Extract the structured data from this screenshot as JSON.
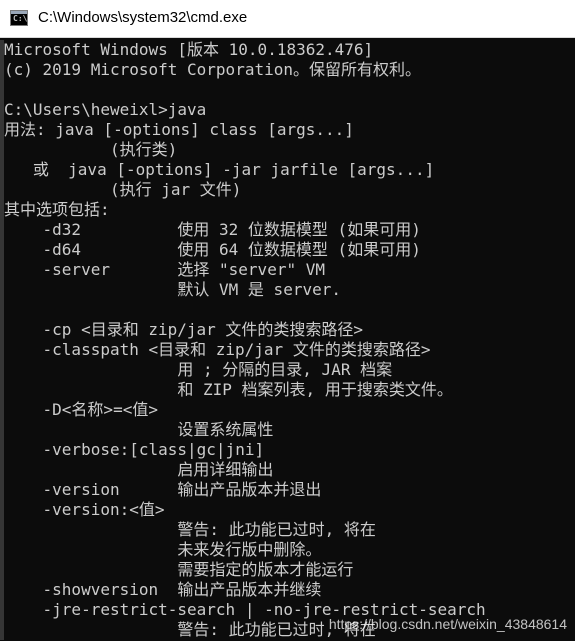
{
  "window": {
    "title": "C:\\Windows\\system32\\cmd.exe",
    "icon": "cmd-console-icon"
  },
  "colors": {
    "background": "#0c0c0c",
    "text": "#cccccc",
    "titlebar": "#ffffff"
  },
  "console": {
    "lines": [
      "Microsoft Windows [版本 10.0.18362.476]",
      "(c) 2019 Microsoft Corporation。保留所有权利。",
      "",
      "C:\\Users\\heweixl>java",
      "用法: java [-options] class [args...]",
      "           (执行类)",
      "   或  java [-options] -jar jarfile [args...]",
      "           (执行 jar 文件)",
      "其中选项包括:",
      "    -d32          使用 32 位数据模型 (如果可用)",
      "    -d64          使用 64 位数据模型 (如果可用)",
      "    -server       选择 \"server\" VM",
      "                  默认 VM 是 server.",
      "",
      "    -cp <目录和 zip/jar 文件的类搜索路径>",
      "    -classpath <目录和 zip/jar 文件的类搜索路径>",
      "                  用 ; 分隔的目录, JAR 档案",
      "                  和 ZIP 档案列表, 用于搜索类文件。",
      "    -D<名称>=<值>",
      "                  设置系统属性",
      "    -verbose:[class|gc|jni]",
      "                  启用详细输出",
      "    -version      输出产品版本并退出",
      "    -version:<值>",
      "                  警告: 此功能已过时, 将在",
      "                  未来发行版中删除。",
      "                  需要指定的版本才能运行",
      "    -showversion  输出产品版本并继续",
      "    -jre-restrict-search | -no-jre-restrict-search",
      "                  警告: 此功能已过时, 将在"
    ]
  },
  "watermark": "https://blog.csdn.net/weixin_43848614"
}
